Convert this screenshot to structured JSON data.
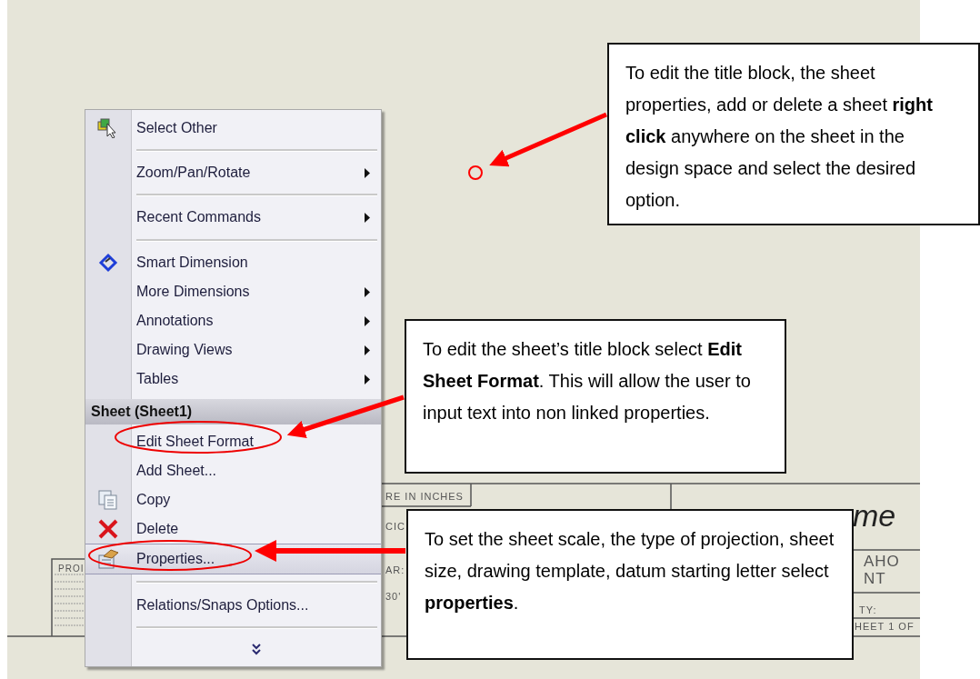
{
  "context_menu": {
    "items": [
      {
        "kind": "item",
        "label": "Select Other",
        "submenu": false,
        "selected": false
      },
      {
        "kind": "separator"
      },
      {
        "kind": "item",
        "label": "Zoom/Pan/Rotate",
        "submenu": true,
        "selected": false
      },
      {
        "kind": "separator"
      },
      {
        "kind": "item",
        "label": "Recent Commands",
        "submenu": true,
        "selected": false
      },
      {
        "kind": "separator"
      },
      {
        "kind": "item",
        "label": "Smart Dimension",
        "submenu": false,
        "selected": false
      },
      {
        "kind": "item",
        "label": "More Dimensions",
        "submenu": true,
        "selected": false
      },
      {
        "kind": "item",
        "label": "Annotations",
        "submenu": true,
        "selected": false
      },
      {
        "kind": "item",
        "label": "Drawing Views",
        "submenu": true,
        "selected": false
      },
      {
        "kind": "item",
        "label": "Tables",
        "submenu": true,
        "selected": false
      },
      {
        "kind": "header",
        "label": "Sheet (Sheet1)"
      },
      {
        "kind": "item",
        "label": "Edit Sheet Format",
        "submenu": false,
        "selected": false
      },
      {
        "kind": "item",
        "label": "Add Sheet...",
        "submenu": false,
        "selected": false
      },
      {
        "kind": "item",
        "label": "Copy",
        "submenu": false,
        "selected": false
      },
      {
        "kind": "item",
        "label": "Delete",
        "submenu": false,
        "selected": false
      },
      {
        "kind": "item",
        "label": "Properties...",
        "submenu": false,
        "selected": true
      },
      {
        "kind": "separator"
      },
      {
        "kind": "item",
        "label": "Relations/Snaps Options...",
        "submenu": false,
        "selected": false
      },
      {
        "kind": "separator"
      },
      {
        "kind": "expand"
      }
    ]
  },
  "title_block": {
    "fragments": [
      "RE IN INCHES",
      "CIC",
      "AR:",
      "30'",
      "me",
      "AHO",
      "NT",
      "TY:",
      "HEET 1 OF",
      "PROI"
    ]
  },
  "callouts": [
    {
      "text": "To edit the title block, the sheet properties, add or delete a sheet **right click** anywhere on the sheet in the design space and select the desired option."
    },
    {
      "text": "To edit the sheet’s title block select **Edit Sheet Format**.  This will allow the user to input text into non linked properties."
    },
    {
      "text": "To set the sheet scale, the type of projection, sheet size, drawing template, datum starting letter select **properties**."
    }
  ]
}
